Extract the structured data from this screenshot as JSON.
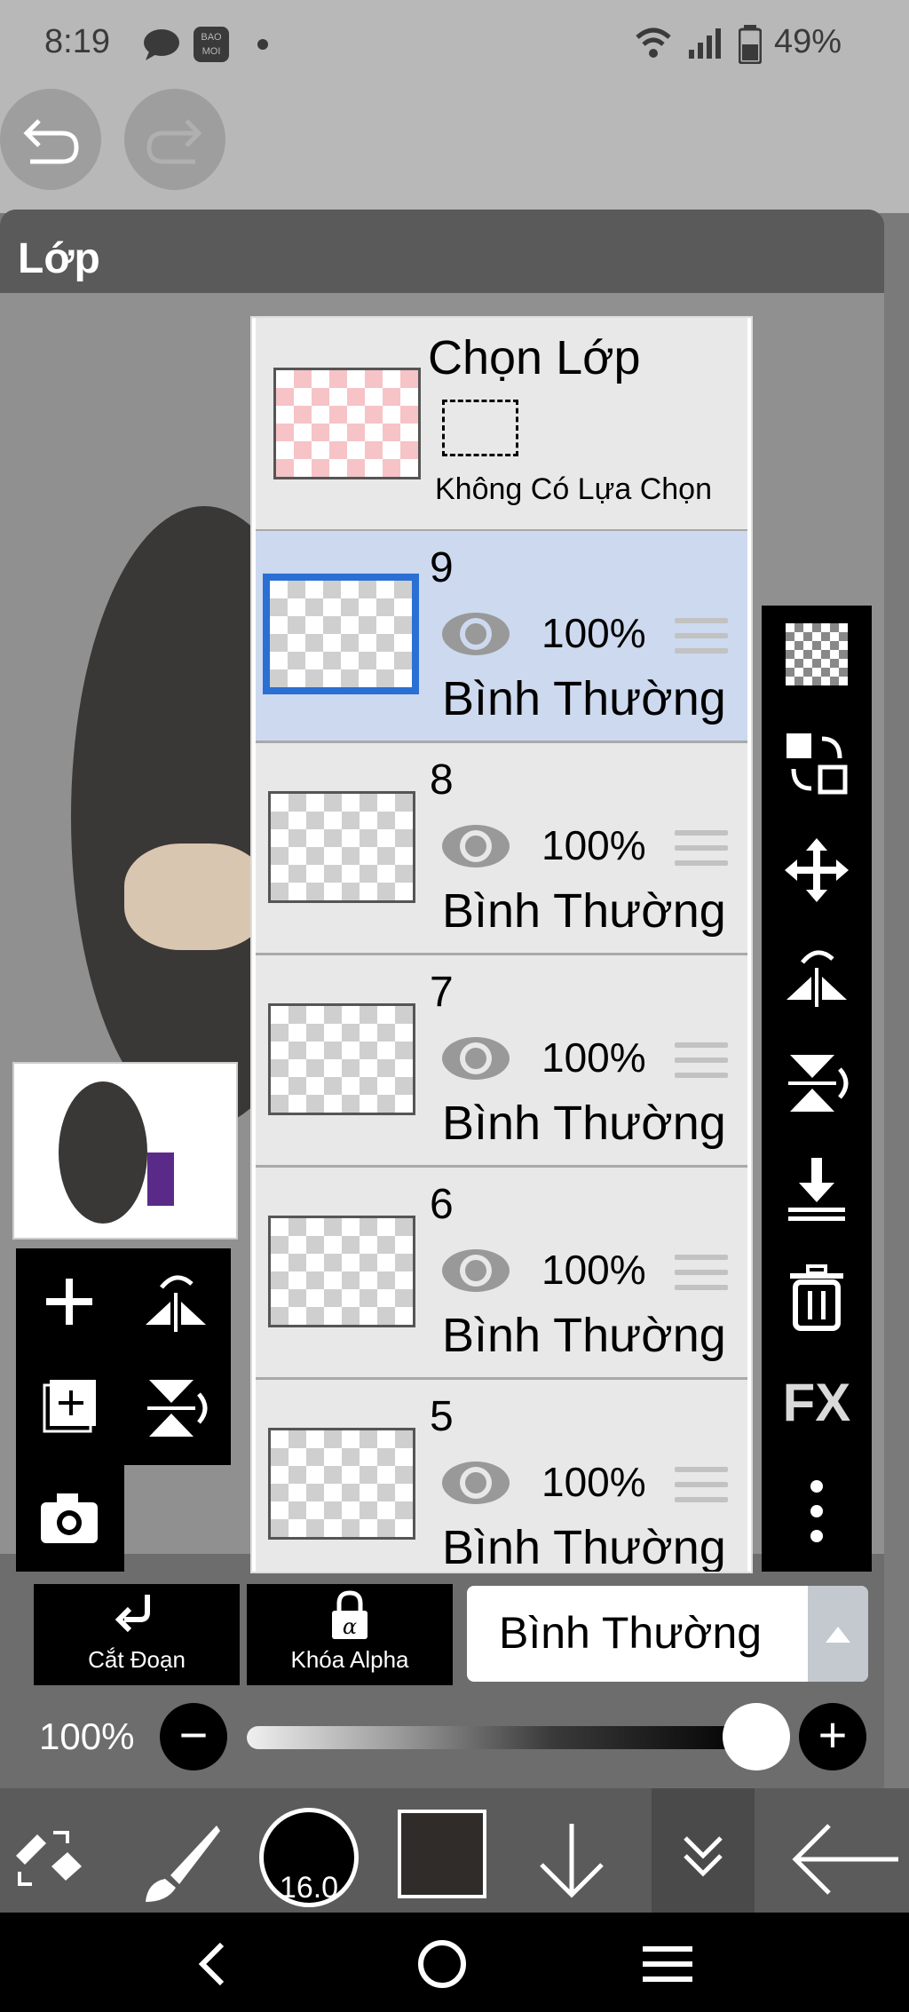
{
  "status": {
    "time": "8:19",
    "battery": "49%",
    "app_badge": "BAO MOI"
  },
  "panel": {
    "title": "Lớp"
  },
  "selection_layer": {
    "title": "Chọn Lớp",
    "status": "Không Có Lựa Chọn"
  },
  "layers": [
    {
      "name": "9",
      "opacity": "100%",
      "blend": "Bình Thường",
      "selected": true
    },
    {
      "name": "8",
      "opacity": "100%",
      "blend": "Bình Thường",
      "selected": false
    },
    {
      "name": "7",
      "opacity": "100%",
      "blend": "Bình Thường",
      "selected": false
    },
    {
      "name": "6",
      "opacity": "100%",
      "blend": "Bình Thường",
      "selected": false
    },
    {
      "name": "5",
      "opacity": "100%",
      "blend": "Bình Thường",
      "selected": false
    }
  ],
  "right_tools": [
    "checker-icon",
    "swap-layer-icon",
    "move-icon",
    "flip-horizontal-icon",
    "flip-vertical-icon",
    "merge-down-icon",
    "trash-icon",
    "FX",
    "more-icon"
  ],
  "bottom_actions": {
    "clip_label": "Cắt Đoạn",
    "alpha_lock_label": "Khóa Alpha",
    "blend_mode": "Bình Thường"
  },
  "opacity": {
    "label": "100%",
    "value": 1.0
  },
  "brush": {
    "size": "16.0"
  },
  "colors": {
    "accent": "#2a6fd4",
    "foreground": "#2f2c2a"
  }
}
